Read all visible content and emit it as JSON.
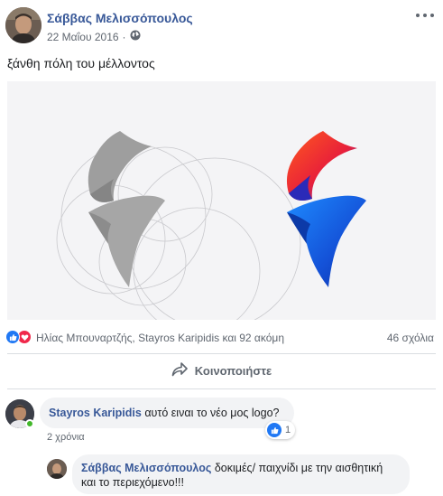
{
  "post": {
    "author": "Σάββας Μελισσόπουλος",
    "date": "22 Μαΐου 2016",
    "separator": "·",
    "text": "ξάνθη πόλη του μέλλοντος"
  },
  "reactions": {
    "names": "Ηλίας Μπουναρτζής, Stayros Karipidis και 92 ακόμη",
    "comments_count": "46 σχόλια"
  },
  "actions": {
    "share_label": "Κοινοποιήστε"
  },
  "comments": [
    {
      "author": "Stayros Karipidis",
      "text": "αυτό ειναι το νέο μος logo?",
      "like_count": "1",
      "time": "2 χρόνια"
    }
  ],
  "replies": [
    {
      "author": "Σάββας Μελισσόπουλος",
      "text_line1": "δοκιμές/ παιχνίδι με την αισθητική",
      "text_line2": "και το περιεχόμενο!!!"
    }
  ],
  "colors": {
    "link": "#385898",
    "like": "#2078f4",
    "love": "#f0284a",
    "online": "#42b72a"
  },
  "icons": [
    "more-options-icon",
    "globe-icon",
    "like-reaction-icon",
    "love-reaction-icon",
    "share-arrow-icon"
  ]
}
